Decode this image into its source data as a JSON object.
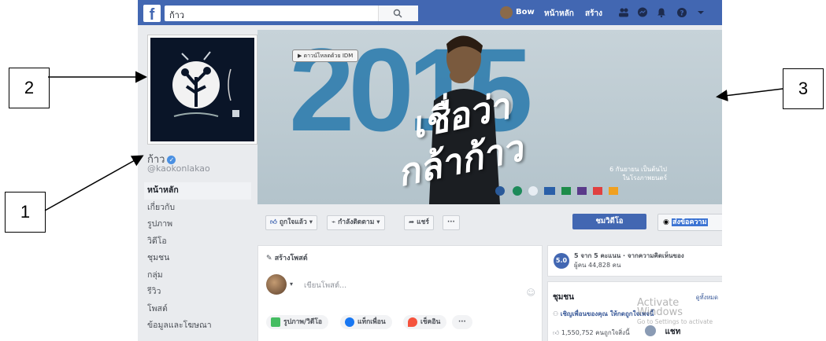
{
  "topbar": {
    "logo": "f",
    "search_value": "ก้าว",
    "user_name": "Bow",
    "nav_home": "หน้าหลัก",
    "nav_create": "สร้าง",
    "color": "#4267b2"
  },
  "profile": {
    "name": "ก้าว",
    "handle": "@kaokonlakao",
    "side_nav": [
      "หน้าหลัก",
      "เกี่ยวกับ",
      "รูปภาพ",
      "วิดีโอ",
      "ชุมชน",
      "กลุ่ม",
      "รีวิว",
      "โพสต์",
      "ข้อมูลและโฆษณา"
    ]
  },
  "cover": {
    "year": "2015",
    "title_line1": "เชื่อว่า",
    "title_line2": "กล้าก้าว",
    "idm_button": "ดาวน์โหลดด้วย IDM",
    "subtitle_line1": "6 กันยายน เป็นต้นไป",
    "subtitle_line2": "ในโรงภาพยนตร์"
  },
  "actions": {
    "like": "ถูกใจแล้ว",
    "follow": "กำลังติดตาม",
    "share": "แชร์",
    "more": "···",
    "watch_video": "ชมวิดีโอ",
    "send_message": "ส่งข้อความ"
  },
  "create_post": {
    "header": "สร้างโพสต์",
    "placeholder": "เขียนโพสต์...",
    "photo_video": "รูปภาพ/วิดีโอ",
    "tag_friends": "แท็กเพื่อน",
    "check_in": "เช็คอิน",
    "more": "···"
  },
  "rating": {
    "score": "5.0",
    "line1": "5 จาก 5 คะแนน · จากความคิดเห็นของ",
    "line2": "ผู้คน 44,828 คน"
  },
  "community": {
    "title": "ชุมชน",
    "see_all": "ดูทั้งหมด",
    "invite": "เชิญเพื่อนของคุณ ให้กดถูกใจเพจนี้",
    "likes": "1,550,752 คนถูกใจสิ่งนี้"
  },
  "watermark": {
    "line1": "Activate Windows",
    "line2": "Go to Settings to activate"
  },
  "chat": "แชท",
  "annotations": [
    "1",
    "2",
    "3"
  ]
}
